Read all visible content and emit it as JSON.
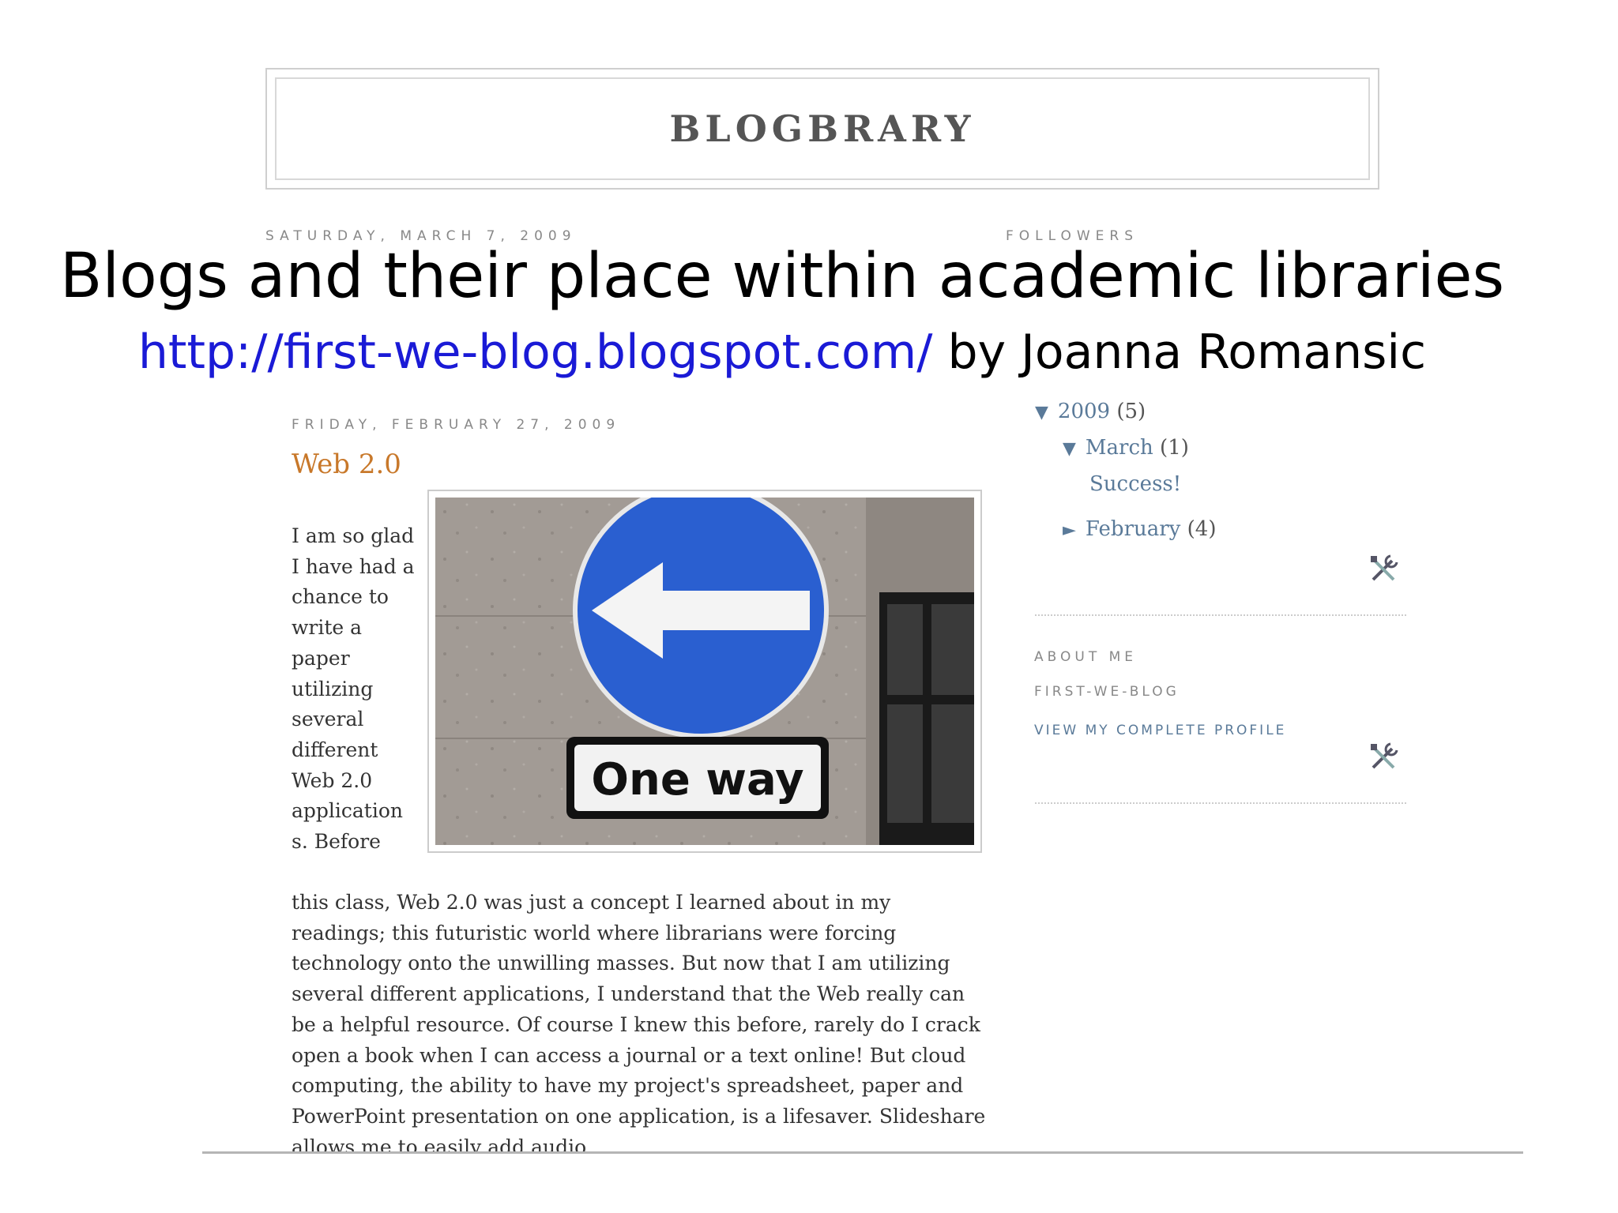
{
  "blog": {
    "title": "BLOGBRARY",
    "date_top": "SATURDAY, MARCH 7, 2009",
    "followers_label": "FOLLOWERS"
  },
  "slide": {
    "title": "Blogs and their place within academic libraries",
    "link": "http://first-we-blog.blogspot.com/",
    "byline": " by Joanna Romansic"
  },
  "post": {
    "date": "FRIDAY, FEBRUARY 27, 2009",
    "title": "Web 2.0",
    "image_sign_text": "One way",
    "text_narrow": "I am so glad I have had a chance to write a paper utilizing several different Web 2.0 application s. Before",
    "text_wide": "this class, Web 2.0 was just a concept I learned about in my readings; this futuristic world where librarians were forcing technology onto the unwilling masses. But now that I am utilizing several different applications, I understand that the Web really can be a helpful resource. Of course I knew this before, rarely do I crack open a book when I can access a journal or a text online! But cloud computing, the ability to have my project's spreadsheet, paper and PowerPoint presentation on one application, is a lifesaver. Slideshare allows me to easily add audio"
  },
  "sidebar": {
    "archive": {
      "year": "2009",
      "year_count": "(5)",
      "month_open": "March",
      "month_open_count": "(1)",
      "post_link": "Success!",
      "month_closed": "February",
      "month_closed_count": "(4)"
    },
    "about": {
      "heading": "ABOUT ME",
      "name": "FIRST-WE-BLOG",
      "profile_link": "VIEW MY COMPLETE PROFILE"
    }
  },
  "icons": {
    "expanded": "triangle-down-icon",
    "collapsed": "triangle-right-icon",
    "edit": "tools-icon"
  },
  "colors": {
    "link": "#1a1ad6",
    "sidebar_link": "#5a7a99",
    "post_title": "#c8782a"
  }
}
